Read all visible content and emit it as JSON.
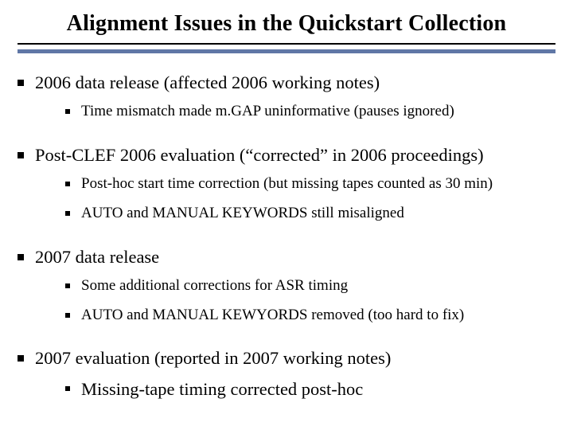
{
  "title": "Alignment Issues in the Quickstart Collection",
  "items": [
    {
      "text": "2006 data release (affected 2006 working notes)",
      "sub": [
        "Time mismatch made m.GAP uninformative (pauses ignored)"
      ]
    },
    {
      "text": "Post-CLEF 2006 evaluation (“corrected” in 2006 proceedings)",
      "sub": [
        "Post-hoc start time correction (but missing tapes counted as 30 min)",
        "AUTO and MANUAL KEYWORDS still misaligned"
      ]
    },
    {
      "text": "2007 data release",
      "sub": [
        "Some additional corrections for ASR timing",
        "AUTO and MANUAL KEWYORDS removed (too hard to fix)"
      ]
    },
    {
      "text": "2007 evaluation (reported in 2007 working notes)",
      "sub": [
        "Missing-tape timing corrected post-hoc"
      ],
      "subLarge": true
    }
  ]
}
